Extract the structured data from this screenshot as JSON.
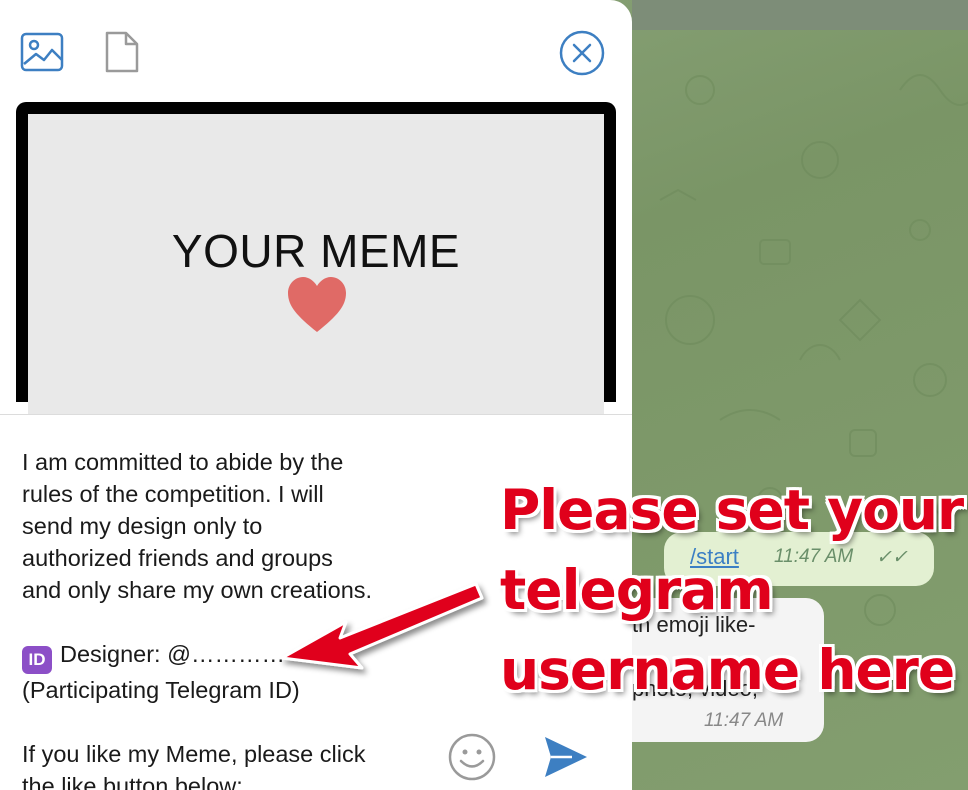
{
  "chat": {
    "bubble_start": {
      "command": "/start",
      "time": "11:47 AM",
      "ticks": "✓✓"
    },
    "bubble_reply": {
      "line1": "th emoji like-",
      "line2": "photo, video,",
      "time": "11:47 AM"
    }
  },
  "sheet": {
    "toolbar": {
      "photo_icon": "image-icon",
      "file_icon": "file-icon",
      "close_icon": "close-icon"
    },
    "preview": {
      "title": "YOUR MEME",
      "heart_color": "#e06a66"
    },
    "caption": {
      "line1": "I am committed to abide by the",
      "line2": "rules of the competition. I will",
      "line3": "send my design only to",
      "line4": "authorized friends and groups",
      "line5": "and only share my own creations.",
      "id_badge": "ID",
      "designer": "Designer: @…………",
      "participating": "(Participating Telegram ID)",
      "like_line1": "If you like my Meme, please click",
      "like_line2": "the like button below:"
    },
    "emoji_icon": "smiley-icon",
    "send_icon": "send-icon",
    "accent": "#3d7fc2"
  },
  "annotation": {
    "line1": "Please set your",
    "line2": "telegram",
    "line3": "username here",
    "color": "#e0001b"
  }
}
